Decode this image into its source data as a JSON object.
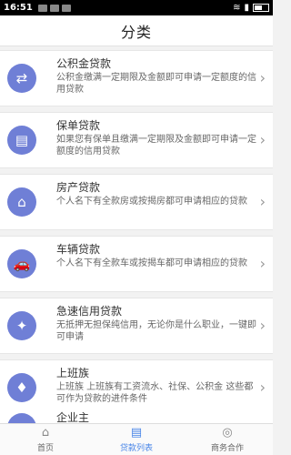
{
  "status": {
    "time": "16:51"
  },
  "header": {
    "title": "分类"
  },
  "categories": [
    {
      "name": "公积金贷款",
      "desc": "公积金缴满一定期限及金额即可申请一定额度的信用贷款",
      "icon": "exchange-icon",
      "glyph": "⇄"
    },
    {
      "name": "保单贷款",
      "desc": "如果您有保单且缴满一定期限及金额即可申请一定额度的信用贷款",
      "icon": "document-icon",
      "glyph": "▤"
    },
    {
      "name": "房产贷款",
      "desc": "个人名下有全款房或按揭房都可申请相应的贷款",
      "icon": "house-icon",
      "glyph": "⌂"
    },
    {
      "name": "车辆贷款",
      "desc": "个人名下有全款车或按揭车都可申请相应的贷款",
      "icon": "car-icon",
      "glyph": "🚗"
    },
    {
      "name": "急速信用贷款",
      "desc": "无抵押无担保纯信用，无论你是什么职业，一键即可申请",
      "icon": "credit-icon",
      "glyph": "✦"
    },
    {
      "name": "上班族",
      "desc": "上班族 上班族有工资流水、社保、公积金 这些都可作为贷款的进件条件",
      "icon": "tie-icon",
      "glyph": "♦"
    }
  ],
  "partial_item": {
    "name": "企业主",
    "icon": "briefcase-icon",
    "glyph": "▣"
  },
  "tabs": [
    {
      "label": "首页",
      "icon": "home-icon",
      "glyph": "⌂",
      "active": false
    },
    {
      "label": "贷款列表",
      "icon": "list-icon",
      "glyph": "▤",
      "active": true
    },
    {
      "label": "商务合作",
      "icon": "cooperation-icon",
      "glyph": "◎",
      "active": false
    }
  ]
}
